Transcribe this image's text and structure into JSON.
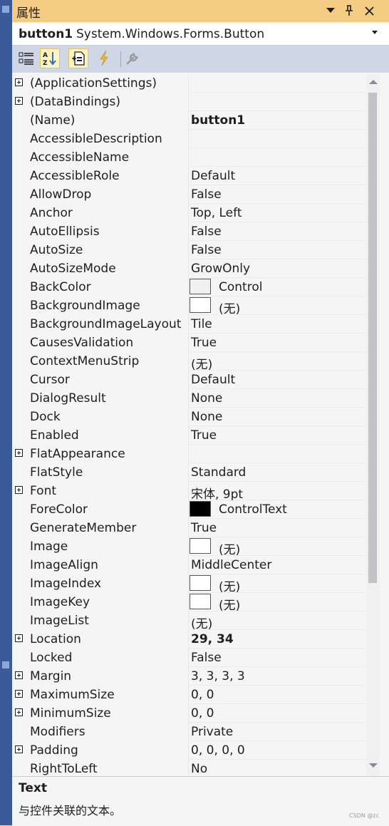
{
  "window": {
    "title": "属性"
  },
  "object_selector": {
    "name": "button1",
    "type": "System.Windows.Forms.Button"
  },
  "toolbar": {
    "buttons": [
      {
        "icon": "categorized-icon",
        "active": false
      },
      {
        "icon": "alphabetical-sort-icon",
        "active": true
      },
      {
        "icon": "properties-icon",
        "active": true
      },
      {
        "icon": "events-lightning-icon",
        "active": false
      },
      {
        "icon": "property-pages-wrench-icon",
        "active": false
      }
    ]
  },
  "properties": [
    {
      "name": "(ApplicationSettings)",
      "value": "",
      "expandable": true
    },
    {
      "name": "(DataBindings)",
      "value": "",
      "expandable": true
    },
    {
      "name": "(Name)",
      "value": "button1",
      "bold": true
    },
    {
      "name": "AccessibleDescription",
      "value": ""
    },
    {
      "name": "AccessibleName",
      "value": ""
    },
    {
      "name": "AccessibleRole",
      "value": "Default"
    },
    {
      "name": "AllowDrop",
      "value": "False"
    },
    {
      "name": "Anchor",
      "value": "Top, Left"
    },
    {
      "name": "AutoEllipsis",
      "value": "False"
    },
    {
      "name": "AutoSize",
      "value": "False"
    },
    {
      "name": "AutoSizeMode",
      "value": "GrowOnly"
    },
    {
      "name": "BackColor",
      "value": "Control",
      "swatch": "#f0f0f0"
    },
    {
      "name": "BackgroundImage",
      "value": "(无)",
      "swatch": "#ffffff"
    },
    {
      "name": "BackgroundImageLayout",
      "value": "Tile"
    },
    {
      "name": "CausesValidation",
      "value": "True"
    },
    {
      "name": "ContextMenuStrip",
      "value": "(无)"
    },
    {
      "name": "Cursor",
      "value": "Default"
    },
    {
      "name": "DialogResult",
      "value": "None"
    },
    {
      "name": "Dock",
      "value": "None"
    },
    {
      "name": "Enabled",
      "value": "True"
    },
    {
      "name": "FlatAppearance",
      "value": "",
      "expandable": true
    },
    {
      "name": "FlatStyle",
      "value": "Standard"
    },
    {
      "name": "Font",
      "value": "宋体, 9pt",
      "expandable": true
    },
    {
      "name": "ForeColor",
      "value": "ControlText",
      "swatch": "#000000"
    },
    {
      "name": "GenerateMember",
      "value": "True"
    },
    {
      "name": "Image",
      "value": "(无)",
      "swatch": "#ffffff"
    },
    {
      "name": "ImageAlign",
      "value": "MiddleCenter"
    },
    {
      "name": "ImageIndex",
      "value": "(无)",
      "swatch": "#ffffff"
    },
    {
      "name": "ImageKey",
      "value": "(无)",
      "swatch": "#ffffff"
    },
    {
      "name": "ImageList",
      "value": "(无)"
    },
    {
      "name": "Location",
      "value": "29, 34",
      "bold": true,
      "expandable": true
    },
    {
      "name": "Locked",
      "value": "False"
    },
    {
      "name": "Margin",
      "value": "3, 3, 3, 3",
      "expandable": true
    },
    {
      "name": "MaximumSize",
      "value": "0, 0",
      "expandable": true
    },
    {
      "name": "MinimumSize",
      "value": "0, 0",
      "expandable": true
    },
    {
      "name": "Modifiers",
      "value": "Private"
    },
    {
      "name": "Padding",
      "value": "0, 0, 0, 0",
      "expandable": true
    },
    {
      "name": "RightToLeft",
      "value": "No"
    }
  ],
  "description": {
    "title": "Text",
    "text": "与控件关联的文本。"
  },
  "watermark": "CSDN @zc",
  "colors": {
    "title_bar": "#f5cc84",
    "toolbar": "#cfd6e5",
    "active_tool": "#fdf4bf",
    "left_strip": "#3a5a99"
  }
}
